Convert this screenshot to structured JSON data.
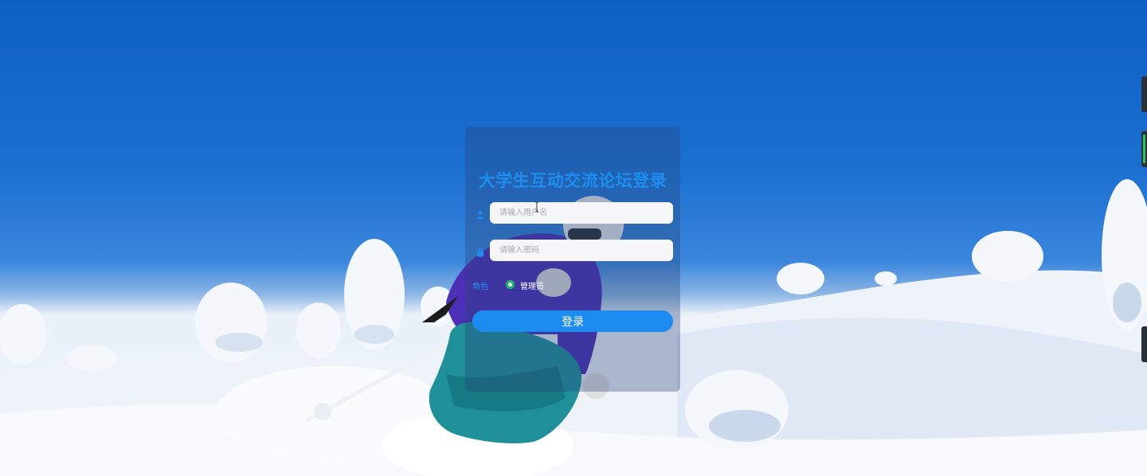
{
  "login": {
    "title": "大学生互动交流论坛登录",
    "username": {
      "placeholder": "请输入用户名",
      "value": ""
    },
    "password": {
      "placeholder": "请输入密码",
      "value": ""
    },
    "role": {
      "label": "角色",
      "options": [
        "管理员"
      ],
      "selected": "管理员"
    },
    "submit_label": "登录"
  },
  "icons": {
    "username": "user-icon",
    "password": "lock-icon"
  },
  "colors": {
    "accent": "#1d8cf0",
    "title": "#1e8ef0",
    "radio_checked": "#19b06a",
    "input_bg": "#f6f6f8"
  }
}
